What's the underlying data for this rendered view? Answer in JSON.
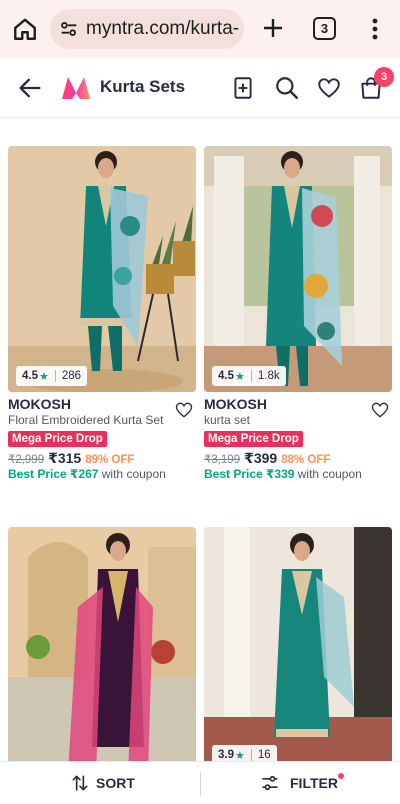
{
  "browser": {
    "url": "myntra.com/kurta-",
    "tab_count": "3"
  },
  "header": {
    "title": "Kurta Sets",
    "bag_count": "3"
  },
  "products": [
    {
      "brand": "MOKOSH",
      "name": "Floral Embroidered Kurta Set",
      "rating": "4.5",
      "rating_count": "286",
      "deal": "Mega Price Drop",
      "mrp": "₹2,999",
      "price": "₹315",
      "discount": "89% OFF",
      "best_price_label": "Best Price",
      "best_price": "₹267",
      "coupon_text": "with coupon"
    },
    {
      "brand": "MOKOSH",
      "name": "kurta set",
      "rating": "4.5",
      "rating_count": "1.8k",
      "deal": "Mega Price Drop",
      "mrp": "₹3,199",
      "price": "₹399",
      "discount": "88% OFF",
      "best_price_label": "Best Price",
      "best_price": "₹339",
      "coupon_text": "with coupon"
    },
    {
      "rating": "",
      "rating_count": ""
    },
    {
      "rating": "3.9",
      "rating_count": "16"
    }
  ],
  "bottom": {
    "sort_label": "SORT",
    "filter_label": "FILTER"
  }
}
